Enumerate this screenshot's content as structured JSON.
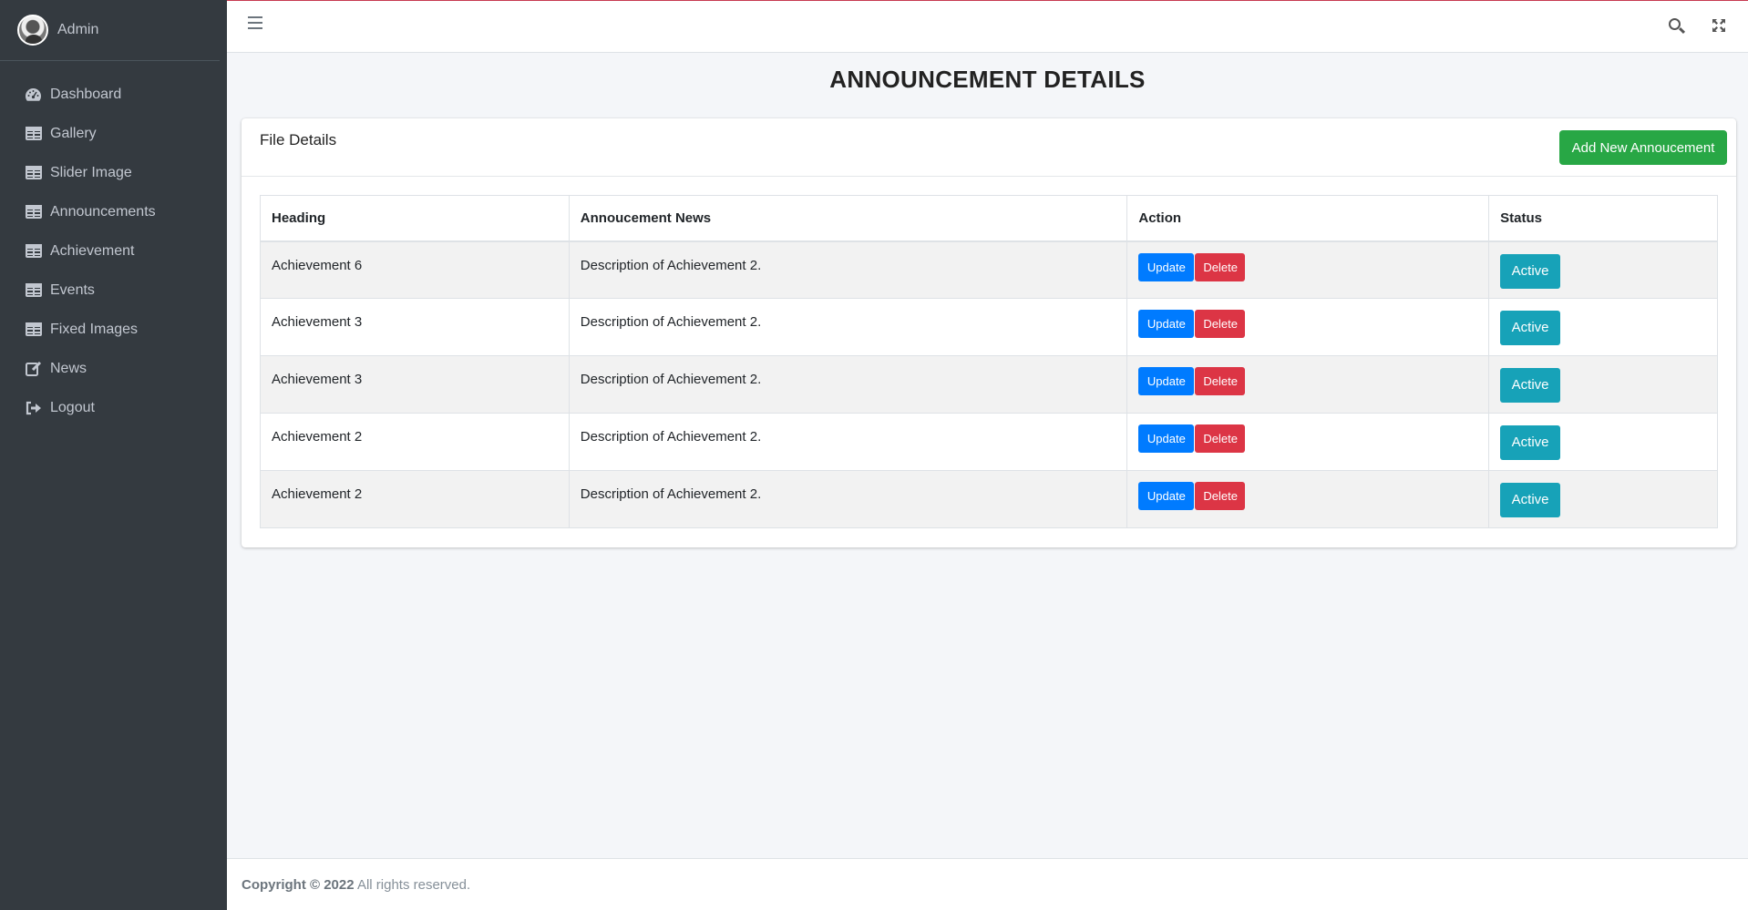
{
  "user": {
    "name": "Admin"
  },
  "sidebar": {
    "items": [
      {
        "label": "Dashboard",
        "icon": "tachometer-icon"
      },
      {
        "label": "Gallery",
        "icon": "table-icon"
      },
      {
        "label": "Slider Image",
        "icon": "table-icon"
      },
      {
        "label": "Announcements",
        "icon": "table-icon"
      },
      {
        "label": "Achievement",
        "icon": "table-icon"
      },
      {
        "label": "Events",
        "icon": "table-icon"
      },
      {
        "label": "Fixed Images",
        "icon": "table-icon"
      },
      {
        "label": "News",
        "icon": "edit-icon"
      },
      {
        "label": "Logout",
        "icon": "sign-out-icon"
      }
    ]
  },
  "header": {
    "menu_icon": "hamburger-icon",
    "search_icon": "search-icon",
    "fullscreen_icon": "expand-icon"
  },
  "page": {
    "title": "ANNOUNCEMENT DETAILS"
  },
  "card": {
    "title": "File Details",
    "add_button": "Add New Annoucement"
  },
  "table": {
    "headers": [
      "Heading",
      "Annoucement News",
      "Action",
      "Status"
    ],
    "rows": [
      {
        "heading": "Achievement 6",
        "news": "Description of Achievement 2.",
        "update": "Update",
        "delete": "Delete",
        "status": "Active"
      },
      {
        "heading": "Achievement 3",
        "news": "Description of Achievement 2.",
        "update": "Update",
        "delete": "Delete",
        "status": "Active"
      },
      {
        "heading": "Achievement 3",
        "news": "Description of Achievement 2.",
        "update": "Update",
        "delete": "Delete",
        "status": "Active"
      },
      {
        "heading": "Achievement 2",
        "news": "Description of Achievement 2.",
        "update": "Update",
        "delete": "Delete",
        "status": "Active"
      },
      {
        "heading": "Achievement 2",
        "news": "Description of Achievement 2.",
        "update": "Update",
        "delete": "Delete",
        "status": "Active"
      }
    ]
  },
  "footer": {
    "copyright": "Copyright © 2022",
    "rights": "All rights reserved."
  },
  "colors": {
    "sidebar": "#343a40",
    "accent_green": "#28a745",
    "update_blue": "#007bff",
    "delete_red": "#dc3545",
    "status_teal": "#17a2b8"
  }
}
